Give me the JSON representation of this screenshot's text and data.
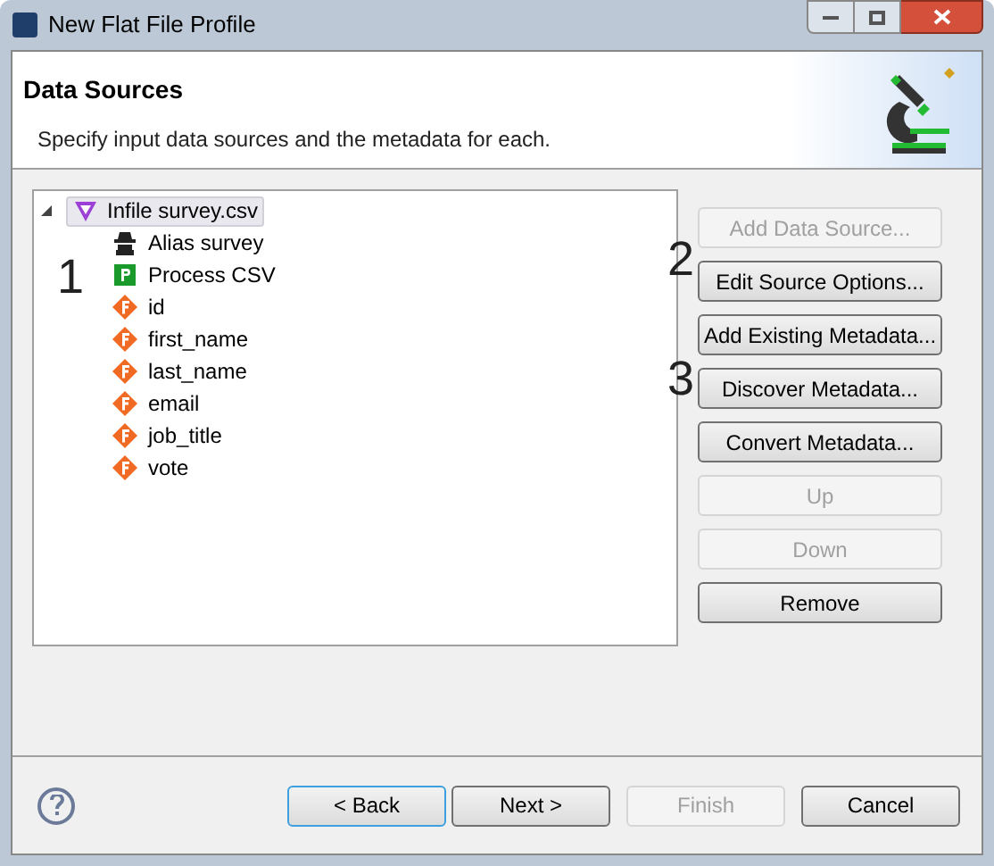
{
  "window": {
    "title": "New Flat File Profile"
  },
  "header": {
    "title": "Data Sources",
    "description": "Specify input data sources and the metadata for each."
  },
  "tree": [
    {
      "label": "Infile survey.csv",
      "kind": "source",
      "selected": true,
      "expanded": true,
      "children": [
        {
          "label": "Alias survey",
          "kind": "alias"
        },
        {
          "label": "Process CSV",
          "kind": "process"
        },
        {
          "label": "id",
          "kind": "field"
        },
        {
          "label": "first_name",
          "kind": "field"
        },
        {
          "label": "last_name",
          "kind": "field"
        },
        {
          "label": "email",
          "kind": "field"
        },
        {
          "label": "job_title",
          "kind": "field"
        },
        {
          "label": "vote",
          "kind": "field"
        }
      ]
    }
  ],
  "side_buttons": [
    {
      "label": "Add Data Source...",
      "disabled": true
    },
    {
      "label": "Edit Source Options...",
      "disabled": false
    },
    {
      "label": "Add Existing Metadata...",
      "disabled": false
    },
    {
      "label": "Discover Metadata...",
      "disabled": false
    },
    {
      "label": "Convert Metadata...",
      "disabled": false
    },
    {
      "label": "Up",
      "disabled": true
    },
    {
      "label": "Down",
      "disabled": true
    },
    {
      "label": "Remove",
      "disabled": false
    }
  ],
  "annotations": [
    {
      "label": "1"
    },
    {
      "label": "2"
    },
    {
      "label": "3"
    }
  ],
  "footer_buttons": [
    {
      "label": "< Back",
      "disabled": false,
      "focused": true
    },
    {
      "label": "Next >",
      "disabled": false,
      "focused": false
    },
    {
      "label": "Finish",
      "disabled": true,
      "focused": false
    },
    {
      "label": "Cancel",
      "disabled": false,
      "focused": false
    }
  ]
}
